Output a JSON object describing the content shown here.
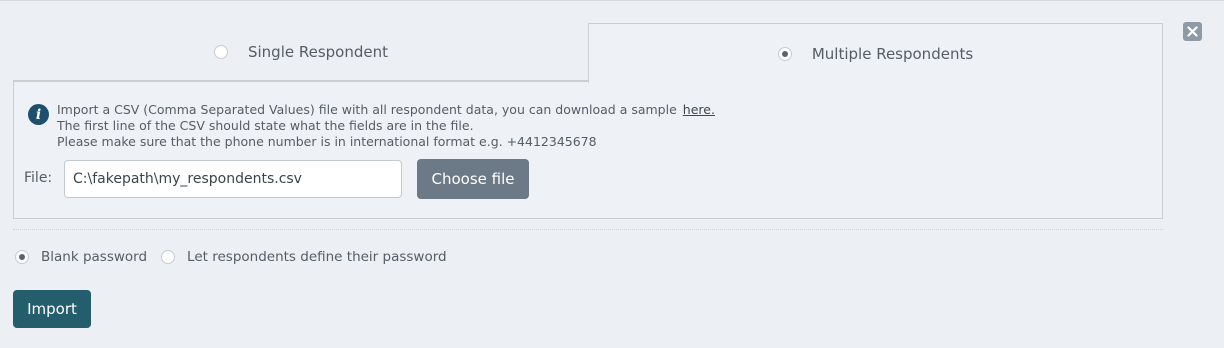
{
  "tabs": {
    "single": {
      "label": "Single Respondent",
      "selected": false
    },
    "multiple": {
      "label": "Multiple Respondents",
      "selected": true
    }
  },
  "info": {
    "line1": "Import a CSV (Comma Separated Values) file with all respondent data, you can download a sample",
    "link_label": "here.",
    "line2": "The first line of the CSV should state what the fields are in the file.",
    "line3": "Please make sure that the phone number is in international format e.g. +4412345678"
  },
  "file": {
    "label": "File:",
    "value": "C:\\fakepath\\my_respondents.csv",
    "choose_label": "Choose file"
  },
  "password_options": {
    "blank": {
      "label": "Blank password",
      "selected": true
    },
    "define": {
      "label": "Let respondents define their password",
      "selected": false
    }
  },
  "import_label": "Import",
  "icons": {
    "close": "close-icon",
    "info": "info-icon"
  }
}
